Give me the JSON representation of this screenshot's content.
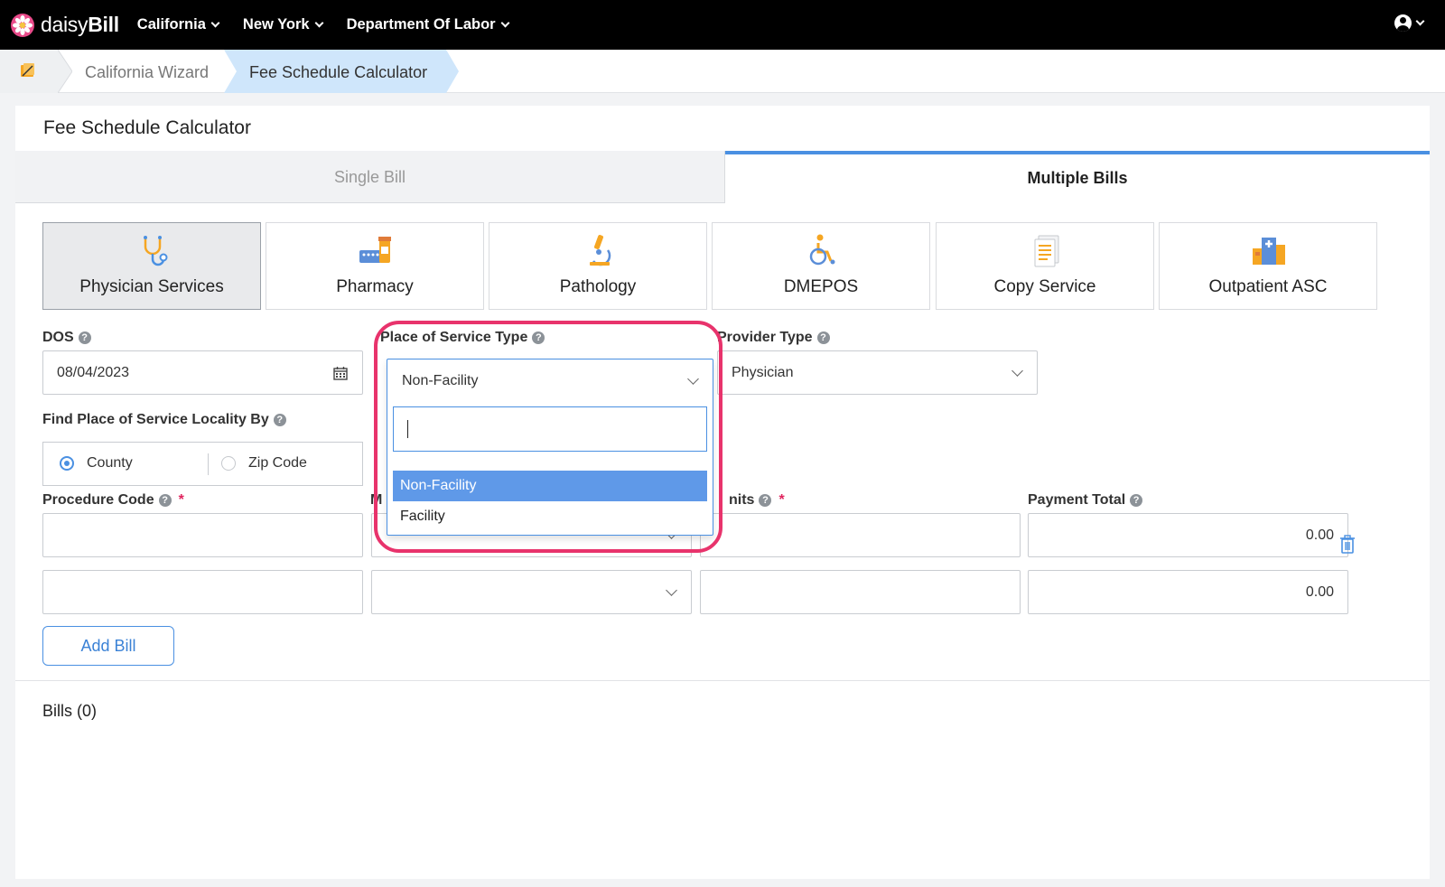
{
  "nav": {
    "brand_prefix": "daisy",
    "brand_suffix": "Bill",
    "menus": [
      "California",
      "New York",
      "Department Of Labor"
    ]
  },
  "breadcrumb": {
    "items": [
      "California Wizard",
      "Fee Schedule Calculator"
    ]
  },
  "page": {
    "title": "Fee Schedule Calculator",
    "tabs": [
      "Single Bill",
      "Multiple Bills"
    ],
    "active_tab": "Multiple Bills"
  },
  "categories": [
    {
      "label": "Physician Services",
      "icon": "stethoscope-icon",
      "active": true
    },
    {
      "label": "Pharmacy",
      "icon": "pharmacy-icon",
      "active": false
    },
    {
      "label": "Pathology",
      "icon": "microscope-icon",
      "active": false
    },
    {
      "label": "DMEPOS",
      "icon": "wheelchair-icon",
      "active": false
    },
    {
      "label": "Copy Service",
      "icon": "document-icon",
      "active": false
    },
    {
      "label": "Outpatient ASC",
      "icon": "hospital-icon",
      "active": false
    }
  ],
  "form": {
    "dos_label": "DOS",
    "dos_value": "08/04/2023",
    "pos_type_label": "Place of Service Type",
    "pos_type_value": "Non-Facility",
    "provider_type_label": "Provider Type",
    "provider_type_value": "Physician",
    "locality_label": "Find Place of Service Locality By",
    "locality_options": [
      "County",
      "Zip Code"
    ],
    "locality_selected": "County",
    "procedure_code_label": "Procedure Code",
    "modifier_label_visible": "M",
    "units_label_visible": "nits",
    "payment_total_label": "Payment Total",
    "rows": [
      {
        "procedure_code": "",
        "modifier": "",
        "units": "",
        "payment_total": "0.00"
      },
      {
        "procedure_code": "",
        "modifier": "",
        "units": "",
        "payment_total": "0.00"
      }
    ],
    "add_bill_label": "Add Bill"
  },
  "dropdown": {
    "search_value": "",
    "options": [
      "Non-Facility",
      "Facility"
    ],
    "highlighted": "Non-Facility"
  },
  "bills": {
    "label": "Bills (0)"
  },
  "colors": {
    "accent": "#4a90e2",
    "highlight_ring": "#e8336c",
    "topbar": "#000000"
  }
}
